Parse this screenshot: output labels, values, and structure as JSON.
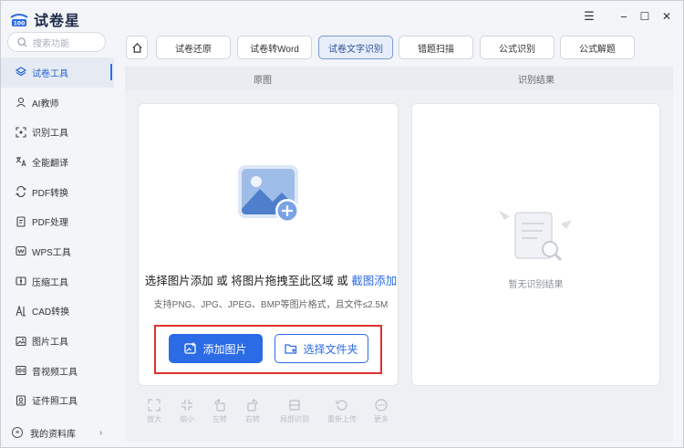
{
  "app": {
    "name": "试卷星",
    "logo_badge": "100"
  },
  "search": {
    "placeholder": "搜索功能"
  },
  "sidebar": {
    "items": [
      {
        "label": "试卷工具",
        "icon": "layers-icon",
        "active": true
      },
      {
        "label": "AI教师",
        "icon": "user-icon"
      },
      {
        "label": "识别工具",
        "icon": "scan-icon"
      },
      {
        "label": "全能翻译",
        "icon": "translate-icon"
      },
      {
        "label": "PDF转换",
        "icon": "convert-icon"
      },
      {
        "label": "PDF处理",
        "icon": "pdf-doc-icon"
      },
      {
        "label": "WPS工具",
        "icon": "wps-icon"
      },
      {
        "label": "压缩工具",
        "icon": "compress-icon"
      },
      {
        "label": "CAD转换",
        "icon": "cad-icon"
      },
      {
        "label": "图片工具",
        "icon": "image-icon"
      },
      {
        "label": "音视频工具",
        "icon": "media-icon"
      },
      {
        "label": "证件照工具",
        "icon": "id-photo-icon"
      }
    ],
    "library": {
      "label": "我的资料库",
      "chevron": "›"
    }
  },
  "window_controls": {
    "menu": "☰",
    "minimize": "−",
    "maximize": "☐",
    "close": "✕"
  },
  "tabs": [
    {
      "label": "试卷还原"
    },
    {
      "label": "试卷转Word"
    },
    {
      "label": "试卷文字识别",
      "active": true
    },
    {
      "label": "错题扫描"
    },
    {
      "label": "公式识别"
    },
    {
      "label": "公式解题"
    }
  ],
  "columns": {
    "original": "原图",
    "result": "识别结果"
  },
  "upload": {
    "prompt_prefix": "选择图片添加 或 将图片拖拽至此区域 或 ",
    "prompt_link": "截图添加",
    "formats": "支持PNG、JPG、JPEG、BMP等图片格式，且文件≤2.5M",
    "add_image_button": "添加图片",
    "choose_folder_button": "选择文件夹"
  },
  "result": {
    "empty_text": "暂无识别结果"
  },
  "toolbar": [
    {
      "label": "放大",
      "icon": "zoom-in-icon"
    },
    {
      "label": "缩小",
      "icon": "zoom-out-icon"
    },
    {
      "label": "左转",
      "icon": "rotate-left-icon"
    },
    {
      "label": "右转",
      "icon": "rotate-right-icon"
    },
    {
      "label": "局部识别",
      "icon": "partial-recognize-icon"
    },
    {
      "label": "重新上传",
      "icon": "reupload-icon"
    },
    {
      "label": "更多",
      "icon": "more-icon"
    }
  ],
  "colors": {
    "accent": "#2c6be6",
    "highlight_border": "#e0302f",
    "sidebar_bg": "#f3f5f8"
  }
}
